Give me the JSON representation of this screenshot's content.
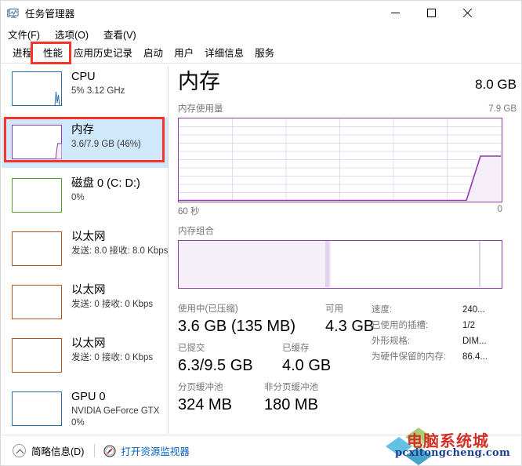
{
  "window": {
    "title": "任务管理器",
    "icon": "task-manager-icon",
    "minimize_label": "–",
    "maximize_label": "□",
    "close_label": "✕"
  },
  "menu": {
    "items": [
      {
        "label": "文件(F)",
        "name": "menu-file"
      },
      {
        "label": "选项(O)",
        "name": "menu-options"
      },
      {
        "label": "查看(V)",
        "name": "menu-view"
      }
    ]
  },
  "tabs": {
    "active": "性能",
    "items": [
      {
        "label": "进程",
        "name": "tab-processes"
      },
      {
        "label": "性能",
        "name": "tab-performance"
      },
      {
        "label": "应用历史记录",
        "name": "tab-app-history"
      },
      {
        "label": "启动",
        "name": "tab-startup"
      },
      {
        "label": "用户",
        "name": "tab-users"
      },
      {
        "label": "详细信息",
        "name": "tab-details"
      },
      {
        "label": "服务",
        "name": "tab-services"
      }
    ]
  },
  "sidebar": {
    "items": [
      {
        "name": "sidebar-item-cpu",
        "title": "CPU",
        "sub": "5% 3.12 GHz",
        "sub2": "",
        "color": "#2a6fa8",
        "selected": false
      },
      {
        "name": "sidebar-item-memory",
        "title": "内存",
        "sub": "3.6/7.9 GB (46%)",
        "sub2": "",
        "color": "#8e3bab",
        "selected": true
      },
      {
        "name": "sidebar-item-disk0",
        "title": "磁盘 0 (C: D:)",
        "sub": "0%",
        "sub2": "",
        "color": "#5c9e2e",
        "selected": false
      },
      {
        "name": "sidebar-item-ethernet-1",
        "title": "以太网",
        "sub": "发送: 8.0 接收: 8.0 Kbps",
        "sub2": "",
        "color": "#b4561a",
        "selected": false
      },
      {
        "name": "sidebar-item-ethernet-2",
        "title": "以太网",
        "sub": "发送: 0 接收: 0 Kbps",
        "sub2": "",
        "color": "#b4561a",
        "selected": false
      },
      {
        "name": "sidebar-item-ethernet-3",
        "title": "以太网",
        "sub": "发送: 0 接收: 0 Kbps",
        "sub2": "",
        "color": "#b4561a",
        "selected": false
      },
      {
        "name": "sidebar-item-gpu0",
        "title": "GPU 0",
        "sub": "NVIDIA GeForce GTX",
        "sub2": "0%",
        "color": "#2a6fa8",
        "selected": false
      }
    ]
  },
  "main": {
    "heading": "内存",
    "total": "8.0 GB",
    "usage_graph_label": "内存使用量",
    "usage_graph_max": "7.9 GB",
    "axis_left": "60 秒",
    "axis_right": "0",
    "composition_label": "内存组合",
    "stats_left": [
      {
        "key": "使用中(已压缩)",
        "value": "3.6 GB (135 MB)",
        "name": "stat-in-use"
      },
      {
        "key": "可用",
        "value": "4.3 GB",
        "name": "stat-available"
      },
      {
        "key": "已提交",
        "value": "6.3/9.5 GB",
        "name": "stat-committed"
      },
      {
        "key": "已缓存",
        "value": "4.0 GB",
        "name": "stat-cached"
      },
      {
        "key": "分页缓冲池",
        "value": "324 MB",
        "name": "stat-paged-pool"
      },
      {
        "key": "非分页缓冲池",
        "value": "180 MB",
        "name": "stat-nonpaged-pool"
      }
    ],
    "stats_right": [
      {
        "key": "速度:",
        "value": "240...",
        "name": "stat-speed"
      },
      {
        "key": "已使用的插槽:",
        "value": "1/2",
        "name": "stat-slots-used"
      },
      {
        "key": "外形规格:",
        "value": "DIM...",
        "name": "stat-form-factor"
      },
      {
        "key": "为硬件保留的内存:",
        "value": "86.4...",
        "name": "stat-hardware-reserved"
      }
    ]
  },
  "chart_data": {
    "type": "area",
    "title": "内存使用量",
    "xlabel": "60 秒",
    "ylabel": "7.9 GB",
    "ylim": [
      0,
      7.9
    ],
    "xlim": [
      60,
      0
    ],
    "grid": true,
    "grid_rows": 10,
    "grid_cols": 6,
    "line_color": "#8e3bab",
    "fill_color": "#f3eaf6",
    "x": [
      60,
      12,
      9,
      0
    ],
    "values": [
      0,
      0,
      3.6,
      3.6
    ],
    "composition": {
      "type": "bar",
      "title": "内存组合",
      "segments": [
        {
          "name": "in-use",
          "fraction": 0.455,
          "fill": "#f4eef7"
        },
        {
          "name": "modified",
          "fraction": 0.012,
          "fill": "#e2cdec"
        },
        {
          "name": "standby-free",
          "fraction": 0.497,
          "fill": "#ffffff"
        },
        {
          "name": "free",
          "fraction": 0.036,
          "fill": "#ffffff"
        }
      ]
    }
  },
  "statusbar": {
    "fewer_details": "简略信息(D)",
    "resource_monitor": "打开资源监视器",
    "resource_monitor_icon": "resource-monitor-icon",
    "chevron_icon": "chevron-up-icon"
  },
  "watermark": {
    "zh": "电脑系统城",
    "en": "pcxitongcheng.com"
  },
  "annotations": [
    {
      "name": "annotation-box-performance-tab"
    },
    {
      "name": "annotation-box-memory-item"
    }
  ]
}
